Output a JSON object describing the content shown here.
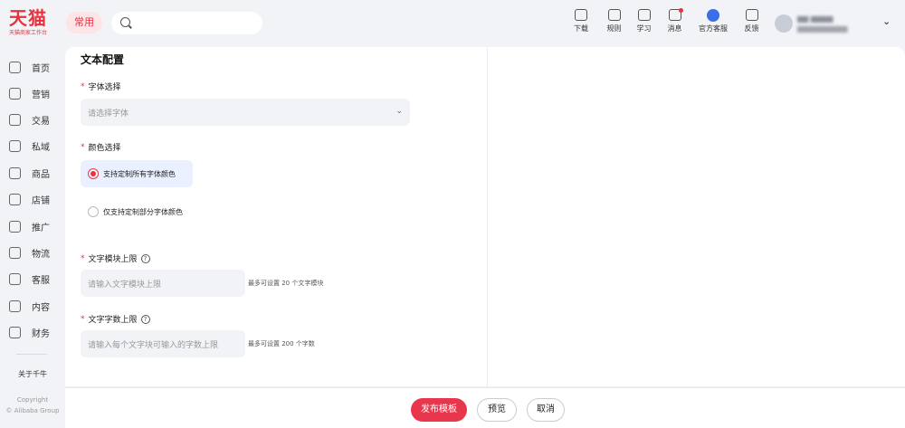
{
  "header": {
    "logo_main": "天猫",
    "logo_sub": "天猫商家工作台",
    "common_label": "常用",
    "tools": [
      {
        "label": "下载",
        "icon": "download-icon"
      },
      {
        "label": "规则",
        "icon": "rules-icon"
      },
      {
        "label": "学习",
        "icon": "learn-icon"
      },
      {
        "label": "消息",
        "icon": "message-icon"
      },
      {
        "label": "官方客服",
        "icon": "customer-service-icon"
      },
      {
        "label": "反馈",
        "icon": "feedback-icon"
      }
    ]
  },
  "sidebar": {
    "items": [
      {
        "label": "首页",
        "icon": "home-icon"
      },
      {
        "label": "营销",
        "icon": "megaphone-icon"
      },
      {
        "label": "交易",
        "icon": "trade-icon"
      },
      {
        "label": "私域",
        "icon": "users-icon"
      },
      {
        "label": "商品",
        "icon": "product-icon"
      },
      {
        "label": "店铺",
        "icon": "shop-icon"
      },
      {
        "label": "推广",
        "icon": "promote-icon"
      },
      {
        "label": "物流",
        "icon": "logistics-icon"
      },
      {
        "label": "客服",
        "icon": "headset-icon"
      },
      {
        "label": "内容",
        "icon": "content-icon"
      },
      {
        "label": "财务",
        "icon": "finance-icon"
      }
    ],
    "about": "关于千牛",
    "copyright_line1": "Copyright",
    "copyright_line2": "© Alibaba Group"
  },
  "form": {
    "title": "文本配置",
    "font_label": "字体选择",
    "font_placeholder": "请选择字体",
    "color_label": "颜色选择",
    "color_options": [
      {
        "label": "支持定制所有字体颜色",
        "selected": true
      },
      {
        "label": "仅支持定制部分字体颜色",
        "selected": false
      }
    ],
    "block_limit_label": "文字模块上限",
    "block_limit_placeholder": "请输入文字模块上限",
    "block_limit_hint": "最多可设置 20 个文字模块",
    "char_limit_label": "文字字数上限",
    "char_limit_placeholder": "请输入每个文字块可输入的字数上限",
    "char_limit_hint": "最多可设置 200 个字数"
  },
  "footer": {
    "publish": "发布模板",
    "preview": "预览",
    "cancel": "取消"
  },
  "colors": {
    "brand": "#e8313f",
    "primary_button": "#e8364d",
    "selected_bg": "#eaf0ff"
  }
}
